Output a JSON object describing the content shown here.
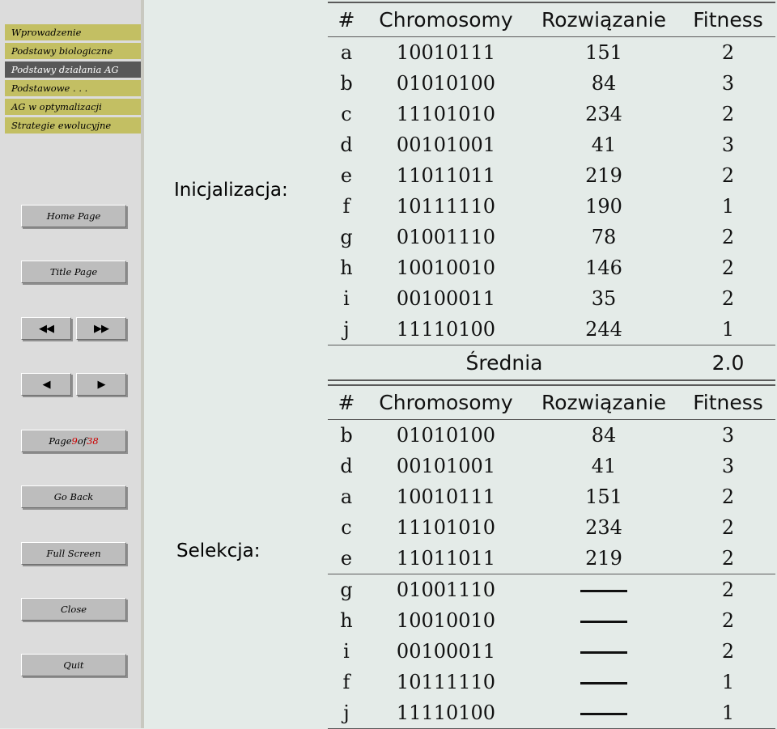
{
  "sidebar": {
    "menu": [
      {
        "label": "Wprowadzenie",
        "active": false
      },
      {
        "label": "Podstawy biologiczne",
        "active": false
      },
      {
        "label": "Podstawy działania AG",
        "active": true
      },
      {
        "label": "Podstawowe . . .",
        "active": false
      },
      {
        "label": "AG w optymalizacji",
        "active": false
      },
      {
        "label": "Strategie ewolucyjne",
        "active": false
      }
    ],
    "buttons": {
      "home": "Home Page",
      "title": "Title Page",
      "first": "◀◀",
      "last": "▶▶",
      "prev": "◀",
      "next": "▶",
      "page_prefix": "Page ",
      "page_current": "9",
      "page_middle": " of ",
      "page_total": "38",
      "go_back": "Go Back",
      "full_screen": "Full Screen",
      "close": "Close",
      "quit": "Quit"
    },
    "accent_menu": "#c3bf63",
    "accent_active": "#585858",
    "page_number_color": "#cc0000"
  },
  "steps": {
    "initialization": "Inicjalizacja:",
    "selection": "Selekcja:"
  },
  "tables": {
    "headers": [
      "#",
      "Chromosomy",
      "Rozwiązanie",
      "Fitness"
    ],
    "initialization": {
      "rows": [
        {
          "id": "a",
          "chromosome": "10010111",
          "solution": "151",
          "fitness": "2"
        },
        {
          "id": "b",
          "chromosome": "01010100",
          "solution": "84",
          "fitness": "3"
        },
        {
          "id": "c",
          "chromosome": "11101010",
          "solution": "234",
          "fitness": "2"
        },
        {
          "id": "d",
          "chromosome": "00101001",
          "solution": "41",
          "fitness": "3"
        },
        {
          "id": "e",
          "chromosome": "11011011",
          "solution": "219",
          "fitness": "2"
        },
        {
          "id": "f",
          "chromosome": "10111110",
          "solution": "190",
          "fitness": "1"
        },
        {
          "id": "g",
          "chromosome": "01001110",
          "solution": "78",
          "fitness": "2"
        },
        {
          "id": "h",
          "chromosome": "10010010",
          "solution": "146",
          "fitness": "2"
        },
        {
          "id": "i",
          "chromosome": "00100011",
          "solution": "35",
          "fitness": "2"
        },
        {
          "id": "j",
          "chromosome": "11110100",
          "solution": "244",
          "fitness": "1"
        }
      ],
      "average_label": "Średnia",
      "average_value": "2.0"
    },
    "selection": {
      "rows": [
        {
          "id": "b",
          "chromosome": "01010100",
          "solution": "84",
          "fitness": "3",
          "dash": false
        },
        {
          "id": "d",
          "chromosome": "00101001",
          "solution": "41",
          "fitness": "3",
          "dash": false
        },
        {
          "id": "a",
          "chromosome": "10010111",
          "solution": "151",
          "fitness": "2",
          "dash": false
        },
        {
          "id": "c",
          "chromosome": "11101010",
          "solution": "234",
          "fitness": "2",
          "dash": false
        },
        {
          "id": "e",
          "chromosome": "11011011",
          "solution": "219",
          "fitness": "2",
          "dash": false
        },
        {
          "id": "g",
          "chromosome": "01001110",
          "solution": "",
          "fitness": "2",
          "dash": true
        },
        {
          "id": "h",
          "chromosome": "10010010",
          "solution": "",
          "fitness": "2",
          "dash": true
        },
        {
          "id": "i",
          "chromosome": "00100011",
          "solution": "",
          "fitness": "2",
          "dash": true
        },
        {
          "id": "f",
          "chromosome": "10111110",
          "solution": "",
          "fitness": "1",
          "dash": true
        },
        {
          "id": "j",
          "chromosome": "11110100",
          "solution": "",
          "fitness": "1",
          "dash": true
        }
      ],
      "divider_after_index": 4
    }
  }
}
